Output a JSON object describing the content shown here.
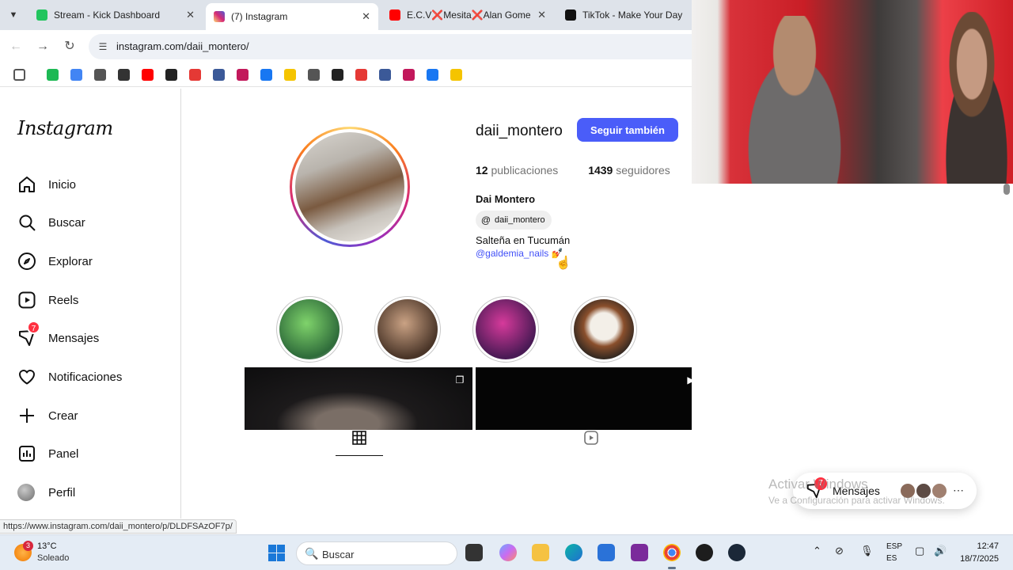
{
  "browser": {
    "tabs": [
      {
        "label": "Stream - Kick Dashboard",
        "favicon_color": "#22c55e"
      },
      {
        "label": "(7) Instagram",
        "favicon_color": "#d62976"
      },
      {
        "label": "E.C.V❌Mesita❌Alan Gomez",
        "favicon_color": "#ff0000"
      },
      {
        "label": "TikTok - Make Your Day",
        "favicon_color": "#111111"
      }
    ],
    "url": "instagram.com/daii_montero/",
    "bookmark_colors": [
      "#555555",
      "#1db954",
      "#4285f4",
      "#555555",
      "#333333",
      "#ff0000",
      "#222222",
      "#e53935",
      "#3b5998",
      "#c2185b",
      "#1877f2",
      "#f5c400",
      "#555555",
      "#222222",
      "#e53935",
      "#3b5998",
      "#c2185b",
      "#1877f2",
      "#f5c400"
    ]
  },
  "sidebar": {
    "logo": "Instagram",
    "items": [
      {
        "label": "Inicio",
        "icon": "home-icon"
      },
      {
        "label": "Buscar",
        "icon": "search-icon"
      },
      {
        "label": "Explorar",
        "icon": "compass-icon"
      },
      {
        "label": "Reels",
        "icon": "reels-icon"
      },
      {
        "label": "Mensajes",
        "icon": "messenger-icon",
        "badge": "7"
      },
      {
        "label": "Notificaciones",
        "icon": "heart-icon"
      },
      {
        "label": "Crear",
        "icon": "plus-icon"
      },
      {
        "label": "Panel",
        "icon": "chart-icon"
      },
      {
        "label": "Perfil",
        "icon": "avatar-icon"
      }
    ]
  },
  "profile": {
    "username": "daii_montero",
    "follow_label": "Seguir también",
    "posts_count": "12",
    "posts_label": "publicaciones",
    "followers_count": "1439",
    "followers_label": "seguidores",
    "full_name": "Dai Montero",
    "threads_handle": "daii_montero",
    "bio": "Salteña en Tucumán",
    "bio_link": "@galdemia_nails 💅"
  },
  "highlights": [
    {
      "emoji": "✨",
      "color1": "#7fd36b",
      "color2": "#2e6b3a"
    },
    {
      "emoji": "🦋",
      "color1": "#caa284",
      "color2": "#4a3528"
    },
    {
      "emoji": "💗",
      "color1": "#d63a9b",
      "color2": "#4a1a55"
    },
    {
      "emoji": "💗",
      "color1": "#f3efe8",
      "color2": "#8a4f2c"
    }
  ],
  "status_link": "https://www.instagram.com/daii_montero/p/DLDFSAzOF7p/",
  "floating_messages": {
    "label": "Mensajes",
    "badge": "7"
  },
  "watermark": {
    "line1": "Activar Windows",
    "line2": "Ve a Configuración para activar Windows."
  },
  "taskbar": {
    "weather_badge": "3",
    "temperature": "13°C",
    "condition": "Soleado",
    "search_label": "Buscar",
    "lang_top": "ESP",
    "lang_bottom": "ES",
    "time": "12:47",
    "date": "18/7/2025"
  }
}
